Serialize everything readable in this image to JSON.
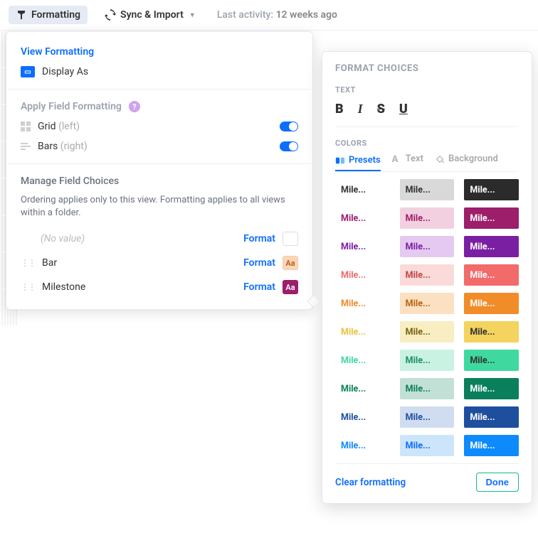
{
  "toolbar": {
    "formatting_label": "Formatting",
    "sync_label": "Sync & Import",
    "last_activity_label": "Last activity:",
    "last_activity_value": "12 weeks ago"
  },
  "panel": {
    "view_formatting": "View Formatting",
    "display_as": "Display As",
    "apply_field_formatting": "Apply Field Formatting",
    "grid_label": "Grid",
    "grid_paren": "(left)",
    "grid_on": true,
    "bars_label": "Bars",
    "bars_paren": "(right)",
    "bars_on": true,
    "manage_choices": "Manage Field Choices",
    "manage_desc": "Ordering applies only to this view. Formatting applies to all views within a folder.",
    "no_value": "(No value)",
    "format_label": "Format",
    "choices": [
      {
        "label": "Bar",
        "swatch_bg": "#fbd7b7",
        "swatch_fg": "#b85c12",
        "swatch_text": "Aa"
      },
      {
        "label": "Milestone",
        "swatch_bg": "#9d1e6b",
        "swatch_fg": "#ffffff",
        "swatch_text": "Aa"
      }
    ]
  },
  "popover": {
    "title": "FORMAT CHOICES",
    "text_section": "TEXT",
    "colors_section": "COLORS",
    "tabs": {
      "presets": "Presets",
      "text": "Text",
      "background": "Background"
    },
    "sample": "Mile...",
    "rows": [
      {
        "c1_bg": "#ffffff",
        "c1_fg": "#333333",
        "c2_bg": "#d9d9d9",
        "c2_fg": "#333333",
        "c3_bg": "#2b2b2b",
        "c3_fg": "#ffffff"
      },
      {
        "c1_bg": "#ffffff",
        "c1_fg": "#9d1e6b",
        "c2_bg": "#f3d0e0",
        "c2_fg": "#9d1e6b",
        "c3_bg": "#9d1e6b",
        "c3_fg": "#ffffff"
      },
      {
        "c1_bg": "#ffffff",
        "c1_fg": "#7b1fa2",
        "c2_bg": "#e5c9f0",
        "c2_fg": "#7b1fa2",
        "c3_bg": "#7b1fa2",
        "c3_fg": "#ffffff"
      },
      {
        "c1_bg": "#ffffff",
        "c1_fg": "#f26a6a",
        "c2_bg": "#fbdada",
        "c2_fg": "#c24444",
        "c3_bg": "#f26a6a",
        "c3_fg": "#ffffff"
      },
      {
        "c1_bg": "#ffffff",
        "c1_fg": "#f28c28",
        "c2_bg": "#fbe0c2",
        "c2_fg": "#b86510",
        "c3_bg": "#f28c28",
        "c3_fg": "#ffffff"
      },
      {
        "c1_bg": "#ffffff",
        "c1_fg": "#e8c23e",
        "c2_bg": "#f8eec2",
        "c2_fg": "#7a6210",
        "c3_bg": "#f4d35e",
        "c3_fg": "#333333"
      },
      {
        "c1_bg": "#ffffff",
        "c1_fg": "#3fd9a0",
        "c2_bg": "#c9f2e2",
        "c2_fg": "#1f8f66",
        "c3_bg": "#3fd9a0",
        "c3_fg": "#333333"
      },
      {
        "c1_bg": "#ffffff",
        "c1_fg": "#0a7f5b",
        "c2_bg": "#c2e0d5",
        "c2_fg": "#0a7f5b",
        "c3_bg": "#0a7f5b",
        "c3_fg": "#ffffff"
      },
      {
        "c1_bg": "#ffffff",
        "c1_fg": "#1e4f9e",
        "c2_bg": "#d0ddf0",
        "c2_fg": "#1e4f9e",
        "c3_bg": "#1e4f9e",
        "c3_fg": "#ffffff"
      },
      {
        "c1_bg": "#ffffff",
        "c1_fg": "#0d8bfd",
        "c2_bg": "#cde5fb",
        "c2_fg": "#0d6efd",
        "c3_bg": "#0d8bfd",
        "c3_fg": "#ffffff"
      }
    ],
    "clear": "Clear formatting",
    "done": "Done"
  }
}
